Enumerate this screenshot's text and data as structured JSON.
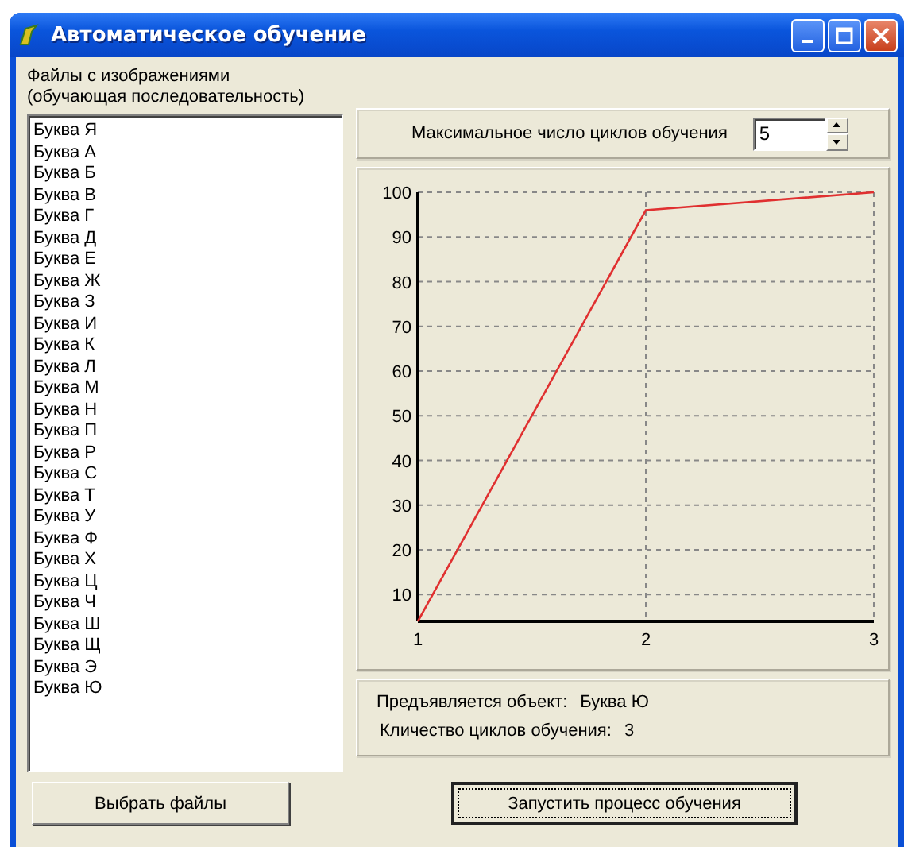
{
  "window": {
    "title": "Автоматическое обучение"
  },
  "files": {
    "label_lines": [
      "Файлы с изображениями",
      "(обучающая последовательность)"
    ],
    "items": [
      "Буква Я",
      "Буква А",
      "Буква Б",
      "Буква В",
      "Буква Г",
      "Буква Д",
      "Буква Е",
      "Буква Ж",
      "Буква З",
      "Буква И",
      "Буква К",
      "Буква Л",
      "Буква М",
      "Буква Н",
      "Буква П",
      "Буква Р",
      "Буква С",
      "Буква Т",
      "Буква У",
      "Буква Ф",
      "Буква Х",
      "Буква Ц",
      "Буква Ч",
      "Буква Ш",
      "Буква Щ",
      "Буква Э",
      "Буква Ю"
    ]
  },
  "max_cycles": {
    "label": "Максимальное число циклов обучения",
    "value": "5"
  },
  "chart_data": {
    "type": "line",
    "x": [
      1,
      2,
      3
    ],
    "series": [
      {
        "color": "#e03030",
        "values": [
          4,
          96,
          100
        ]
      }
    ],
    "grid": true,
    "xlim": [
      1,
      3
    ],
    "ylim": [
      4,
      100
    ],
    "xticks": [
      1,
      2,
      3
    ],
    "yticks": [
      10,
      20,
      30,
      40,
      50,
      60,
      70,
      80,
      90,
      100
    ]
  },
  "info": [
    {
      "label": "Предъявляется объект:",
      "value": "Буква Ю"
    },
    {
      "label": "Кличество циклов обучения:",
      "value": "3"
    }
  ],
  "buttons": {
    "choose": "Выбрать файлы",
    "start": "Запустить процесс обучения"
  }
}
